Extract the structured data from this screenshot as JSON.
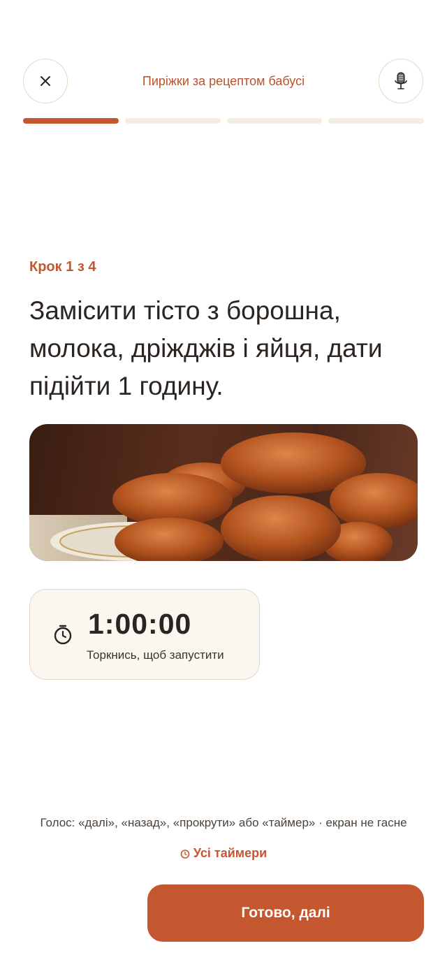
{
  "header": {
    "title": "Пиріжки за рецептом бабусі",
    "close_icon": "close-icon",
    "mic_icon": "microphone-icon"
  },
  "progress": {
    "total_steps": 4,
    "current_step": 1
  },
  "step": {
    "label": "Крок 1 з 4",
    "instruction": "Замісити тісто з борошна, молока, дріжджів і яйця, дати підійти 1 годину."
  },
  "timer": {
    "value": "1:00:00",
    "hint": "Торкнись, щоб запустити",
    "icon": "stopwatch-icon"
  },
  "footer": {
    "voice_hint": "Голос: «далі», «назад», «прокрути» або «таймер» · екран не гасне",
    "all_timers_label": "Усі таймери",
    "next_button_label": "Готово, далі"
  },
  "colors": {
    "accent": "#c4572f",
    "title": "#b8532b",
    "card_bg": "#fbf7f0",
    "border": "#e6d9c3",
    "progress_inactive": "#f5ede1"
  }
}
